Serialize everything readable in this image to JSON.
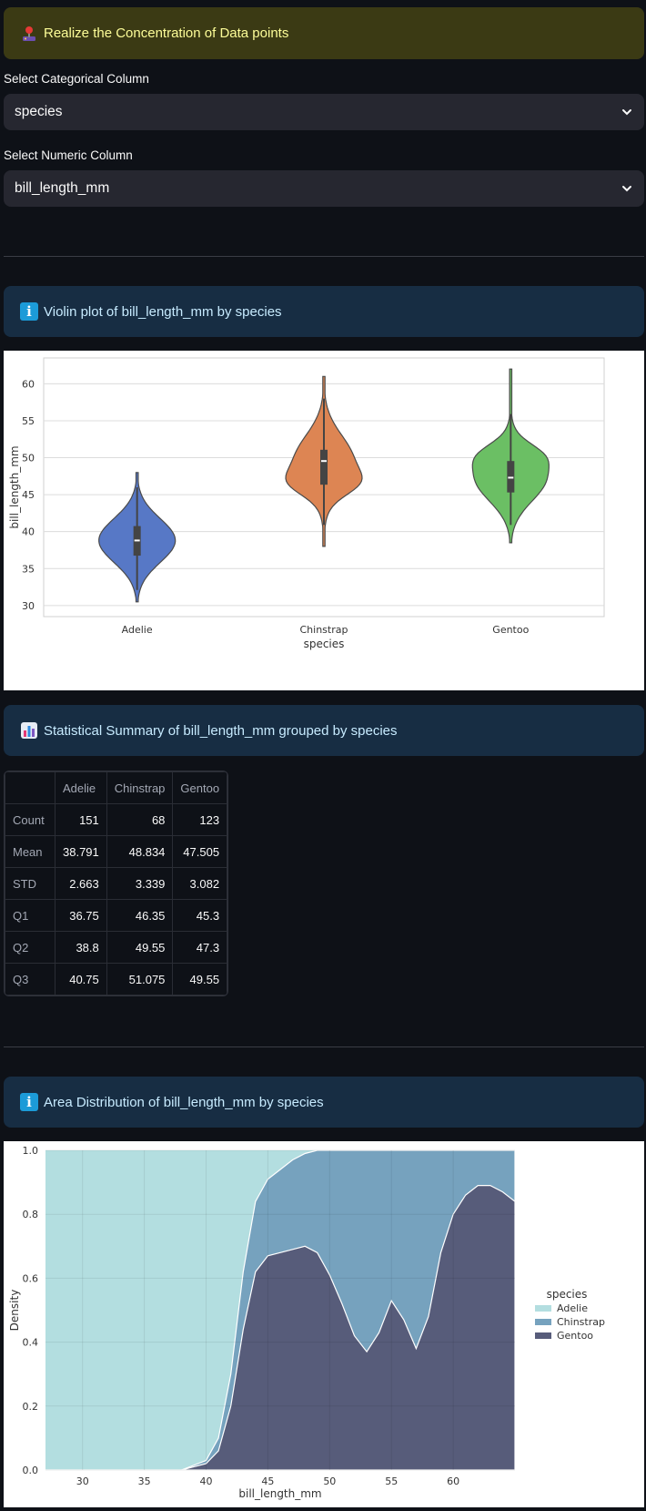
{
  "warning": {
    "icon": "joystick-icon",
    "text": "Realize the Concentration of Data points"
  },
  "categorical": {
    "label": "Select Categorical Column",
    "value": "species"
  },
  "numeric": {
    "label": "Select Numeric Column",
    "value": "bill_length_mm"
  },
  "info_violin": {
    "text": "Violin plot of bill_length_mm by species"
  },
  "info_summary": {
    "text": "Statistical Summary of bill_length_mm grouped by species"
  },
  "info_area": {
    "text": "Area Distribution of bill_length_mm by species"
  },
  "summary": {
    "columns": [
      "",
      "Adelie",
      "Chinstrap",
      "Gentoo"
    ],
    "rows": [
      {
        "label": "Count",
        "values": [
          "151",
          "68",
          "123"
        ]
      },
      {
        "label": "Mean",
        "values": [
          "38.791",
          "48.834",
          "47.505"
        ]
      },
      {
        "label": "STD",
        "values": [
          "2.663",
          "3.339",
          "3.082"
        ]
      },
      {
        "label": "Q1",
        "values": [
          "36.75",
          "46.35",
          "45.3"
        ]
      },
      {
        "label": "Q2",
        "values": [
          "38.8",
          "49.55",
          "47.3"
        ]
      },
      {
        "label": "Q3",
        "values": [
          "40.75",
          "51.075",
          "49.55"
        ]
      }
    ]
  },
  "chart_data": [
    {
      "type": "violin",
      "categories": [
        "Adelie",
        "Chinstrap",
        "Gentoo"
      ],
      "colors": [
        "#5778c6",
        "#dd8553",
        "#6bbf64"
      ],
      "xlabel": "species",
      "ylabel": "bill_length_mm",
      "ylim": [
        28.5,
        63.5
      ],
      "yticks": [
        30,
        35,
        40,
        45,
        50,
        55,
        60
      ],
      "grid": true,
      "series": [
        {
          "name": "Adelie",
          "min": 30.5,
          "max": 48,
          "q1": 36.75,
          "median": 38.8,
          "q3": 40.75,
          "whisker_low": 32.1,
          "whisker_high": 46
        },
        {
          "name": "Chinstrap",
          "min": 38,
          "max": 61,
          "q1": 46.35,
          "median": 49.55,
          "q3": 51.075,
          "whisker_low": 40.9,
          "whisker_high": 58
        },
        {
          "name": "Gentoo",
          "min": 38.5,
          "max": 62,
          "q1": 45.3,
          "median": 47.3,
          "q3": 49.55,
          "whisker_low": 40.9,
          "whisker_high": 55.9
        }
      ]
    },
    {
      "type": "area",
      "xlabel": "bill_length_mm",
      "ylabel": "Density",
      "xlim": [
        27,
        65
      ],
      "ylim": [
        0,
        1
      ],
      "xticks": [
        30,
        35,
        40,
        45,
        50,
        55,
        60
      ],
      "yticks": [
        0.0,
        0.2,
        0.4,
        0.6,
        0.8,
        1.0
      ],
      "legend": {
        "title": "species",
        "placement": "center-right"
      },
      "x": [
        27,
        38,
        40,
        41,
        42,
        43,
        44,
        45,
        46,
        47,
        48,
        49,
        50,
        51,
        52,
        53,
        54,
        55,
        56,
        57,
        58,
        59,
        60,
        61,
        62,
        63,
        64,
        65
      ],
      "series": [
        {
          "name": "Adelie",
          "color": "#b3dee0",
          "values": [
            1,
            1,
            1,
            1,
            1,
            1,
            1,
            1,
            1,
            1,
            1,
            1,
            1,
            1,
            1,
            1,
            1,
            1,
            1,
            1,
            1,
            1,
            1,
            1,
            1,
            1,
            1,
            1
          ]
        },
        {
          "name": "Chinstrap",
          "color": "#76a2be",
          "values": [
            0,
            0,
            0.03,
            0.1,
            0.3,
            0.62,
            0.84,
            0.91,
            0.94,
            0.97,
            0.99,
            1,
            1,
            1,
            1,
            1,
            1,
            1,
            1,
            1,
            1,
            1,
            1,
            1,
            1,
            1,
            1,
            1
          ]
        },
        {
          "name": "Gentoo",
          "color": "#575c7a",
          "values": [
            0,
            0,
            0.02,
            0.06,
            0.2,
            0.44,
            0.62,
            0.67,
            0.68,
            0.69,
            0.7,
            0.68,
            0.61,
            0.52,
            0.42,
            0.37,
            0.43,
            0.53,
            0.47,
            0.38,
            0.48,
            0.68,
            0.8,
            0.86,
            0.89,
            0.89,
            0.87,
            0.84
          ]
        }
      ]
    }
  ]
}
